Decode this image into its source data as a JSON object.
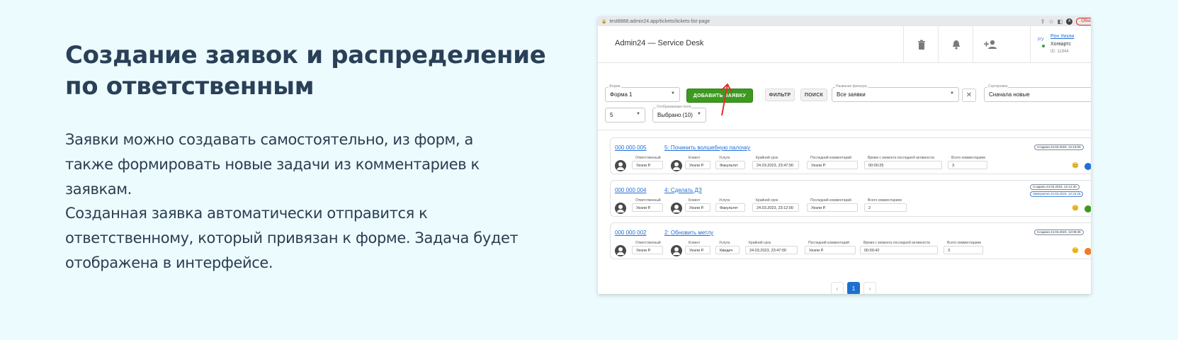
{
  "left": {
    "heading": "Создание заявок и распределение по ответственным",
    "p1": "Заявки можно создавать самостоятельно, из форм, а также формировать новые задачи из комментариев к заявкам.",
    "p2": "Созданная заявка автоматически отправится к ответственному, который привязан к форме. Задача будет отображена в интерфейсе."
  },
  "browser": {
    "url": "test8888.admin24.app/tickets/tickets-list-page",
    "avatar_letter": "A",
    "update_label": "Обно"
  },
  "app": {
    "title": "Admin24 — Service Desk",
    "user": {
      "lang": "РУ",
      "name": "Рон Уизли",
      "org": "Хогвартс",
      "id": "ID: 11944"
    }
  },
  "toolbar": {
    "form_label": "Форма",
    "form_value": "Форма 1",
    "add_button": "ДОБАВИТЬ ЗАЯВКУ",
    "filter_button": "ФИЛЬТР",
    "search_button": "ПОИСК",
    "filter_name_label": "Название фильтра",
    "filter_name_value": "Все заявки",
    "sort_label": "Сортировка",
    "sort_value": "Сначала новые",
    "page_size_value": "5",
    "fields_label": "Отображаемые поля",
    "fields_value": "Выбрано (10)"
  },
  "tickets": [
    {
      "number": "000 000 005",
      "title": "5: Починить волшебную палочку",
      "dates": [
        "Создана 24.03.2023, 12:23:05"
      ],
      "responsible_label": "Ответственный",
      "responsible": "Уизли Р.",
      "client_label": "Клиент",
      "client": "Уизли Р.",
      "service_label": "Услуга",
      "service": "Факультет",
      "deadline_label": "Крайний срок",
      "deadline": "24.03.2023, 23:47:00",
      "last_comment_label": "Последний комментарий",
      "last_comment": "Уизли Р.",
      "activity_label": "Время с момента последней активности",
      "activity": "00:00:25",
      "comments_label": "Всего комментариев",
      "comments": "3",
      "status_color": "#1e6fd9"
    },
    {
      "number": "000 000 004",
      "title": "4: Сделать ДЗ",
      "dates": [
        "Создана 24.03.2023, 12:12:40",
        "Завершена 24.03.2023, 12:23:25"
      ],
      "responsible_label": "Ответственный",
      "responsible": "Уизли Р.",
      "client_label": "Клиент",
      "client": "Уизли Р.",
      "service_label": "Услуга",
      "service": "Факультет",
      "deadline_label": "Крайний срок",
      "deadline": "24.03.2023, 23:12:00",
      "last_comment_label": "Последний комментарий",
      "last_comment": "Уизли Р.",
      "comments_label": "Всего комментариев",
      "comments": "2",
      "status_color": "#3c9a1f"
    },
    {
      "number": "000 000 002",
      "title": "2: Обновить метлу",
      "dates": [
        "Создана 24.03.2023, 12:08:36"
      ],
      "responsible_label": "Ответственный",
      "responsible": "Уизли Р.",
      "client_label": "Клиент",
      "client": "Уизли Р.",
      "service_label": "Услуга",
      "service": "Квидич",
      "deadline_label": "Крайний срок",
      "deadline": "24.03.2023, 23:47:00",
      "last_comment_label": "Последний комментарий",
      "last_comment": "Уизли Р.",
      "activity_label": "Время с момента последней активности",
      "activity": "00:00:42",
      "comments_label": "Всего комментариев",
      "comments": "3",
      "status_color": "#f07a2a"
    }
  ],
  "pagination": {
    "prev": "‹",
    "current": "1",
    "next": "›"
  }
}
